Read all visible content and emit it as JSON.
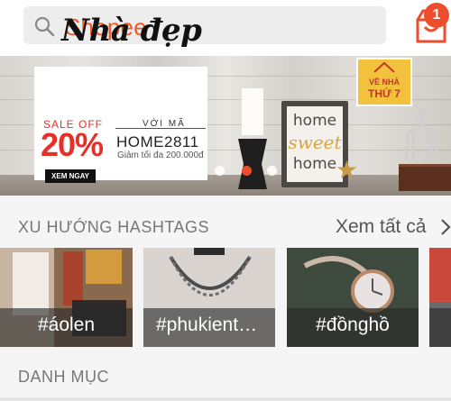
{
  "header": {
    "search_placeholder": "Shopee",
    "cart_count": "1",
    "icons": {
      "search": "search-icon",
      "cart": "cart-icon"
    }
  },
  "banner": {
    "title": "Nhà đẹp",
    "sale_off": "SALE OFF",
    "discount": "20%",
    "code_prefix": "VỚI MÃ",
    "code": "HOME2811",
    "note": "Giảm tối đa 200.000đ",
    "cta": "XEM NGAY",
    "frame_words": [
      "home",
      "sweet",
      "home"
    ],
    "logo_lines": [
      "VỀ NHÀ",
      "THỨ 7"
    ],
    "slide_count": 5,
    "active_slide": 2
  },
  "trending": {
    "title": "XU HƯỚNG HASHTAGS",
    "see_all": "Xem tất cả",
    "items": [
      {
        "label": "#áolen"
      },
      {
        "label": "#phukient…"
      },
      {
        "label": "#đồnghồ"
      }
    ]
  },
  "categories": {
    "title": "DANH MỤC"
  },
  "colors": {
    "brand": "#ee4d2d",
    "brand_text": "#ee5a2c",
    "overlay": "#282828"
  }
}
